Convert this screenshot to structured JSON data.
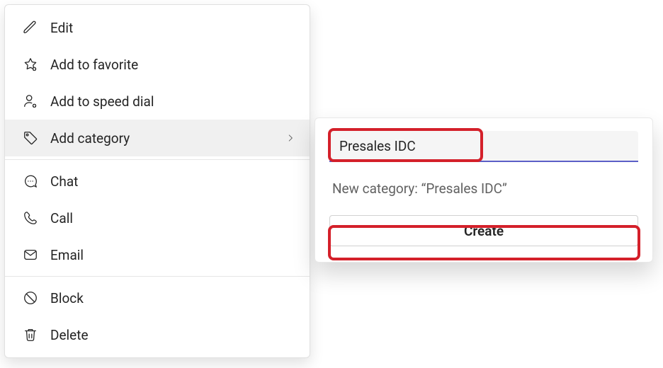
{
  "menu": {
    "items": [
      {
        "label": "Edit"
      },
      {
        "label": "Add to favorite"
      },
      {
        "label": "Add to speed dial"
      },
      {
        "label": "Add category"
      },
      {
        "label": "Chat"
      },
      {
        "label": "Call"
      },
      {
        "label": "Email"
      },
      {
        "label": "Block"
      },
      {
        "label": "Delete"
      }
    ]
  },
  "flyout": {
    "input_value": "Presales IDC",
    "suggestion_text": "New category: “Presales IDC”",
    "create_label": "Create"
  }
}
